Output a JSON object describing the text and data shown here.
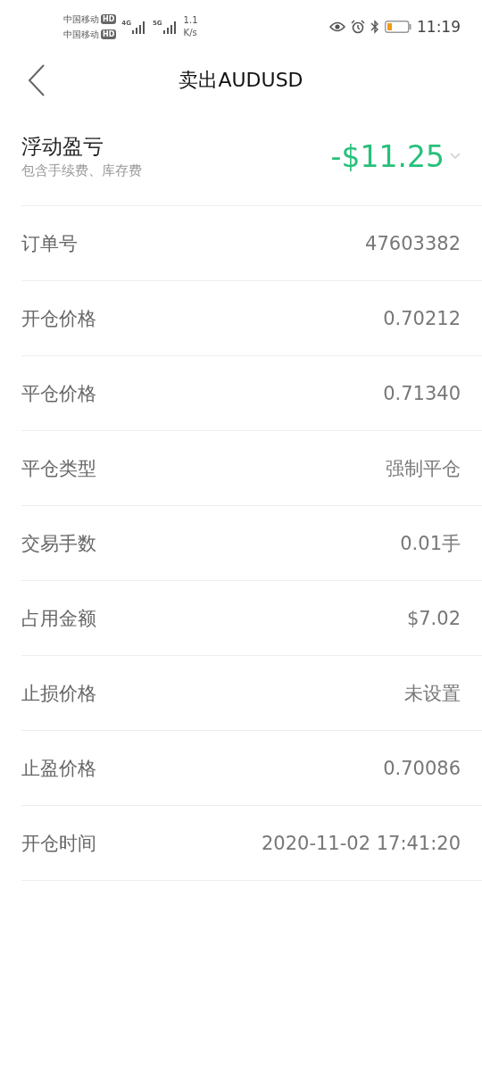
{
  "status_bar": {
    "carriers": [
      {
        "name": "中国移动",
        "badge": "HD"
      },
      {
        "name": "中国移动",
        "badge": "HD"
      }
    ],
    "networks": [
      "4G",
      "5G"
    ],
    "speed": [
      "1.1",
      "K/s"
    ],
    "time": "11:19"
  },
  "header": {
    "title": "卖出AUDUSD"
  },
  "pnl": {
    "label": "浮动盈亏",
    "note": "包含手续费、库存费",
    "value": "-$11.25",
    "expanded": false
  },
  "rows": [
    {
      "label": "订单号",
      "value": "47603382"
    },
    {
      "label": "开仓价格",
      "value": "0.70212"
    },
    {
      "label": "平仓价格",
      "value": "0.71340"
    },
    {
      "label": "平仓类型",
      "value": "强制平仓"
    },
    {
      "label": "交易手数",
      "value": "0.01手"
    },
    {
      "label": "占用金额",
      "value": "$7.02"
    },
    {
      "label": "止损价格",
      "value": "未设置"
    },
    {
      "label": "止盈价格",
      "value": "0.70086"
    },
    {
      "label": "开仓时间",
      "value": "2020-11-02 17:41:20"
    }
  ]
}
